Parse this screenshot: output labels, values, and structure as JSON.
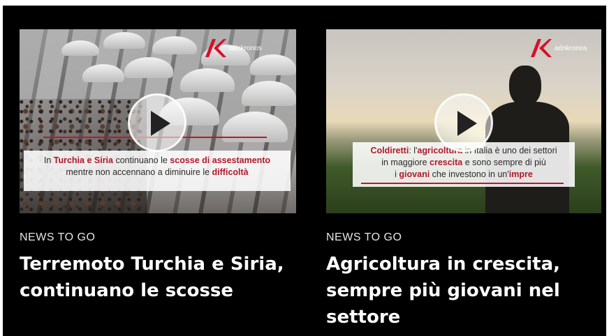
{
  "articles": [
    {
      "section": "NEWS TO GO",
      "headline_line1": "Terremoto Turchia e Siria,",
      "headline_line2": "continuano le scosse",
      "brand": "adnkronos",
      "caption": {
        "line1_a": "In ",
        "line1_b": "Turchia e Siria",
        "line1_c": " continuano le ",
        "line1_d": "scosse di assestamento",
        "line2_a": "mentre non accennano a diminuire le ",
        "line2_b": "difficoltà"
      }
    },
    {
      "section": "NEWS TO GO",
      "headline_line1": "Agricoltura in crescita,",
      "headline_line2": "sempre più giovani nel",
      "headline_line3": "settore",
      "brand": "adnkronos",
      "caption": {
        "line1_a": "Coldiretti",
        "line1_b": ": l'",
        "line1_c": "agricoltura",
        "line1_d": " in Italia è uno dei settori",
        "line2_a": "in maggiore ",
        "line2_b": "crescita",
        "line2_c": " e sono sempre di più",
        "line3_a": "i ",
        "line3_b": "giovani",
        "line3_c": " che investono in un'",
        "line3_d": "impre"
      }
    }
  ],
  "colors": {
    "background": "#000000",
    "accent": "#b0182b",
    "brand_red": "#d6102a"
  },
  "icons": {
    "play": "play-icon",
    "brand": "adnkronos-logo"
  }
}
